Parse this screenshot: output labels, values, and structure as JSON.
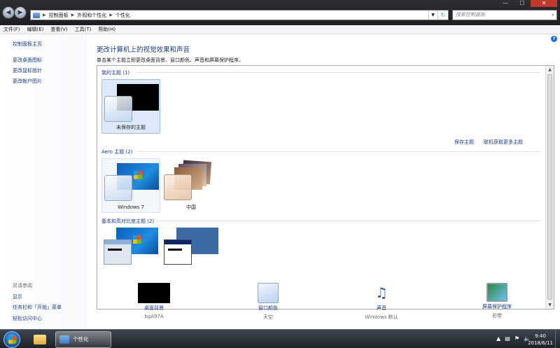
{
  "window": {
    "breadcrumb": [
      "控制面板",
      "外观和个性化",
      "个性化"
    ],
    "search_placeholder": "搜索控制面板",
    "buttons": {
      "minimize": "—",
      "maximize": "☐",
      "close": "✕"
    }
  },
  "menu": [
    "文件(F)",
    "编辑(E)",
    "查看(V)",
    "工具(T)",
    "帮助(H)"
  ],
  "sidebar": {
    "home": "控制面板主页",
    "links": [
      "更改桌面图标",
      "更改鼠标指针",
      "更改帐户图片"
    ],
    "see_also_title": "另请参阅",
    "see_also": [
      "显示",
      "任务栏和「开始」菜单",
      "轻松访问中心"
    ]
  },
  "main": {
    "title": "更改计算机上的视觉效果和声音",
    "subtitle": "单击某个主题立即更改桌面背景、窗口颜色、声音和屏幕保护程序。",
    "groups": {
      "my": {
        "label": "我的主题 (1)",
        "themes": [
          "未保存的主题"
        ]
      },
      "aero": {
        "label": "Aero 主题 (2)",
        "themes": [
          "Windows 7",
          "中国"
        ]
      },
      "basic": {
        "label": "基本和高对比度主题 (2)"
      }
    },
    "save_theme": "保存主题",
    "get_more": "联机获取更多主题"
  },
  "bottom": [
    {
      "title": "桌面背景",
      "sub": "bgA97A"
    },
    {
      "title": "窗口颜色",
      "sub": "天空"
    },
    {
      "title": "声音",
      "sub": "Windows 默认"
    },
    {
      "title": "屏幕保护程序",
      "sub": "彩带"
    }
  ],
  "taskbar": {
    "active_window": "个性化",
    "time": "9:40",
    "date": "2018/6/11"
  },
  "colors": {
    "link": "#1e3b8a",
    "selection": "#dde9f8",
    "win7_blue": "#1f8de0"
  }
}
